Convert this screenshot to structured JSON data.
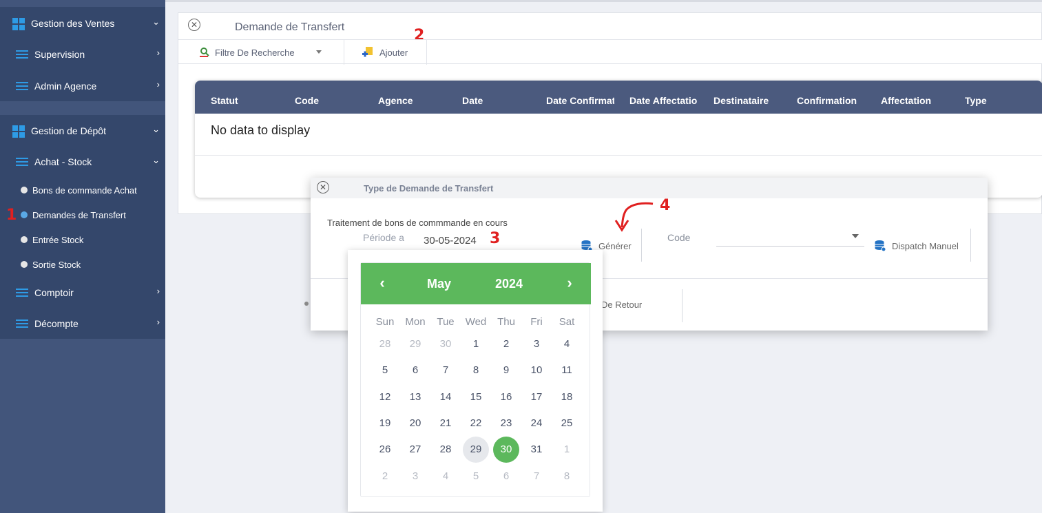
{
  "sidebar": {
    "sections": [
      {
        "label": "Gestion des Ventes",
        "icon": "grid-icon",
        "expanded": true
      },
      {
        "label": "Gestion de Dépôt",
        "icon": "grid-icon",
        "expanded": true
      }
    ],
    "items": [
      {
        "label": "Supervision",
        "icon": "menu-bars-icon"
      },
      {
        "label": "Admin Agence",
        "icon": "menu-bars-icon"
      },
      {
        "label": "Achat - Stock",
        "icon": "menu-bars-icon"
      },
      {
        "label": "Comptoir",
        "icon": "menu-bars-icon"
      },
      {
        "label": "Décompte",
        "icon": "menu-bars-icon"
      }
    ],
    "subitems": [
      {
        "label": "Bons de commande Achat",
        "active": false
      },
      {
        "label": "Demandes de Transfert",
        "active": true
      },
      {
        "label": "Entrée Stock",
        "active": false
      },
      {
        "label": "Sortie Stock",
        "active": false
      }
    ]
  },
  "annotations": [
    "1",
    "2",
    "3",
    "4"
  ],
  "panel": {
    "title": "Demande de Transfert",
    "toolbar": {
      "filter_label": "Filtre De Recherche",
      "add_label": "Ajouter"
    },
    "grid": {
      "columns": [
        "Statut",
        "Code",
        "Agence",
        "Date",
        "Date Confirmat",
        "Date Affectatio",
        "Destinataire",
        "Confirmation",
        "Affectation",
        "Type"
      ],
      "empty_text": "No data to display"
    }
  },
  "dialog": {
    "title": "Type de Demande de Transfert",
    "subtitle": "Traitement de bons de commmande en cours",
    "periode_label": "Période active",
    "date_value": "30-05-2024",
    "generate_label": "Générer",
    "code_label": "Code",
    "code_value": "",
    "dispatch_label": "Dispatch Manuel",
    "retour_label": "De Retour"
  },
  "calendar": {
    "month": "May",
    "year": "2024",
    "prev": "‹",
    "next": "›",
    "weekdays": [
      "Sun",
      "Mon",
      "Tue",
      "Wed",
      "Thu",
      "Fri",
      "Sat"
    ],
    "weeks": [
      [
        "28",
        "29",
        "30",
        "1",
        "2",
        "3",
        "4"
      ],
      [
        "5",
        "6",
        "7",
        "8",
        "9",
        "10",
        "11"
      ],
      [
        "12",
        "13",
        "14",
        "15",
        "16",
        "17",
        "18"
      ],
      [
        "19",
        "20",
        "21",
        "22",
        "23",
        "24",
        "25"
      ],
      [
        "26",
        "27",
        "28",
        "29",
        "30",
        "31",
        "1"
      ],
      [
        "2",
        "3",
        "4",
        "5",
        "6",
        "7",
        "8"
      ]
    ],
    "selected_day": "30",
    "hover_day": "29"
  },
  "colors": {
    "sidebar_bg": "#42557b",
    "sidebar_block": "#34476b",
    "accent_blue": "#2e9be6",
    "grid_header": "#4b5a7e",
    "calendar_green": "#5cb85c",
    "annotation_red": "#e02020"
  }
}
